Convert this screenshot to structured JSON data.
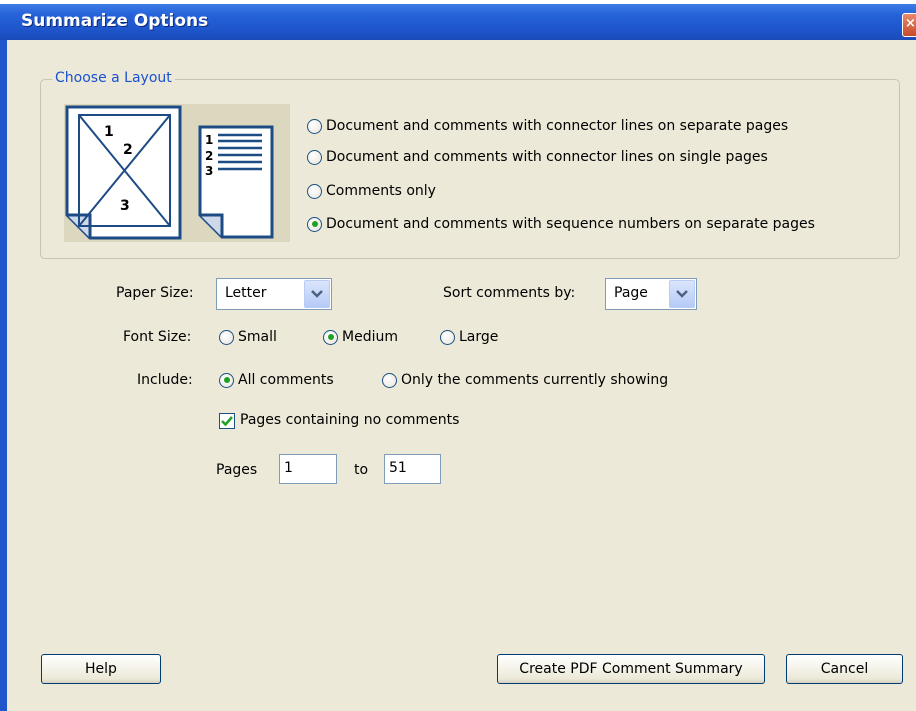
{
  "window": {
    "title": "Summarize Options",
    "close_glyph": "×"
  },
  "layout": {
    "legend": "Choose a Layout",
    "illustration": {
      "numbers_left": [
        "1",
        "2",
        "3"
      ],
      "numbers_right": [
        "1",
        "2",
        "3"
      ]
    },
    "options": [
      {
        "label": "Document and comments with connector lines on separate pages",
        "checked": false
      },
      {
        "label": "Document and comments with connector lines on single pages",
        "checked": false
      },
      {
        "label": "Comments only",
        "checked": false
      },
      {
        "label": "Document and comments with sequence numbers on separate pages",
        "checked": true
      }
    ]
  },
  "paper_size": {
    "label": "Paper Size:",
    "value": "Letter"
  },
  "sort": {
    "label": "Sort comments by:",
    "value": "Page"
  },
  "font_size": {
    "label": "Font Size:",
    "options": [
      {
        "label": "Small",
        "checked": false
      },
      {
        "label": "Medium",
        "checked": true
      },
      {
        "label": "Large",
        "checked": false
      }
    ]
  },
  "include": {
    "label": "Include:",
    "options": [
      {
        "label": "All comments",
        "checked": true
      },
      {
        "label": "Only the comments currently showing",
        "checked": false
      }
    ]
  },
  "pages_no_comments": {
    "label": "Pages containing no comments",
    "checked": true
  },
  "pages": {
    "label": "Pages",
    "from": "1",
    "to_label": "to",
    "to": "51"
  },
  "buttons": {
    "help": "Help",
    "create": "Create PDF Comment Summary",
    "cancel": "Cancel"
  }
}
